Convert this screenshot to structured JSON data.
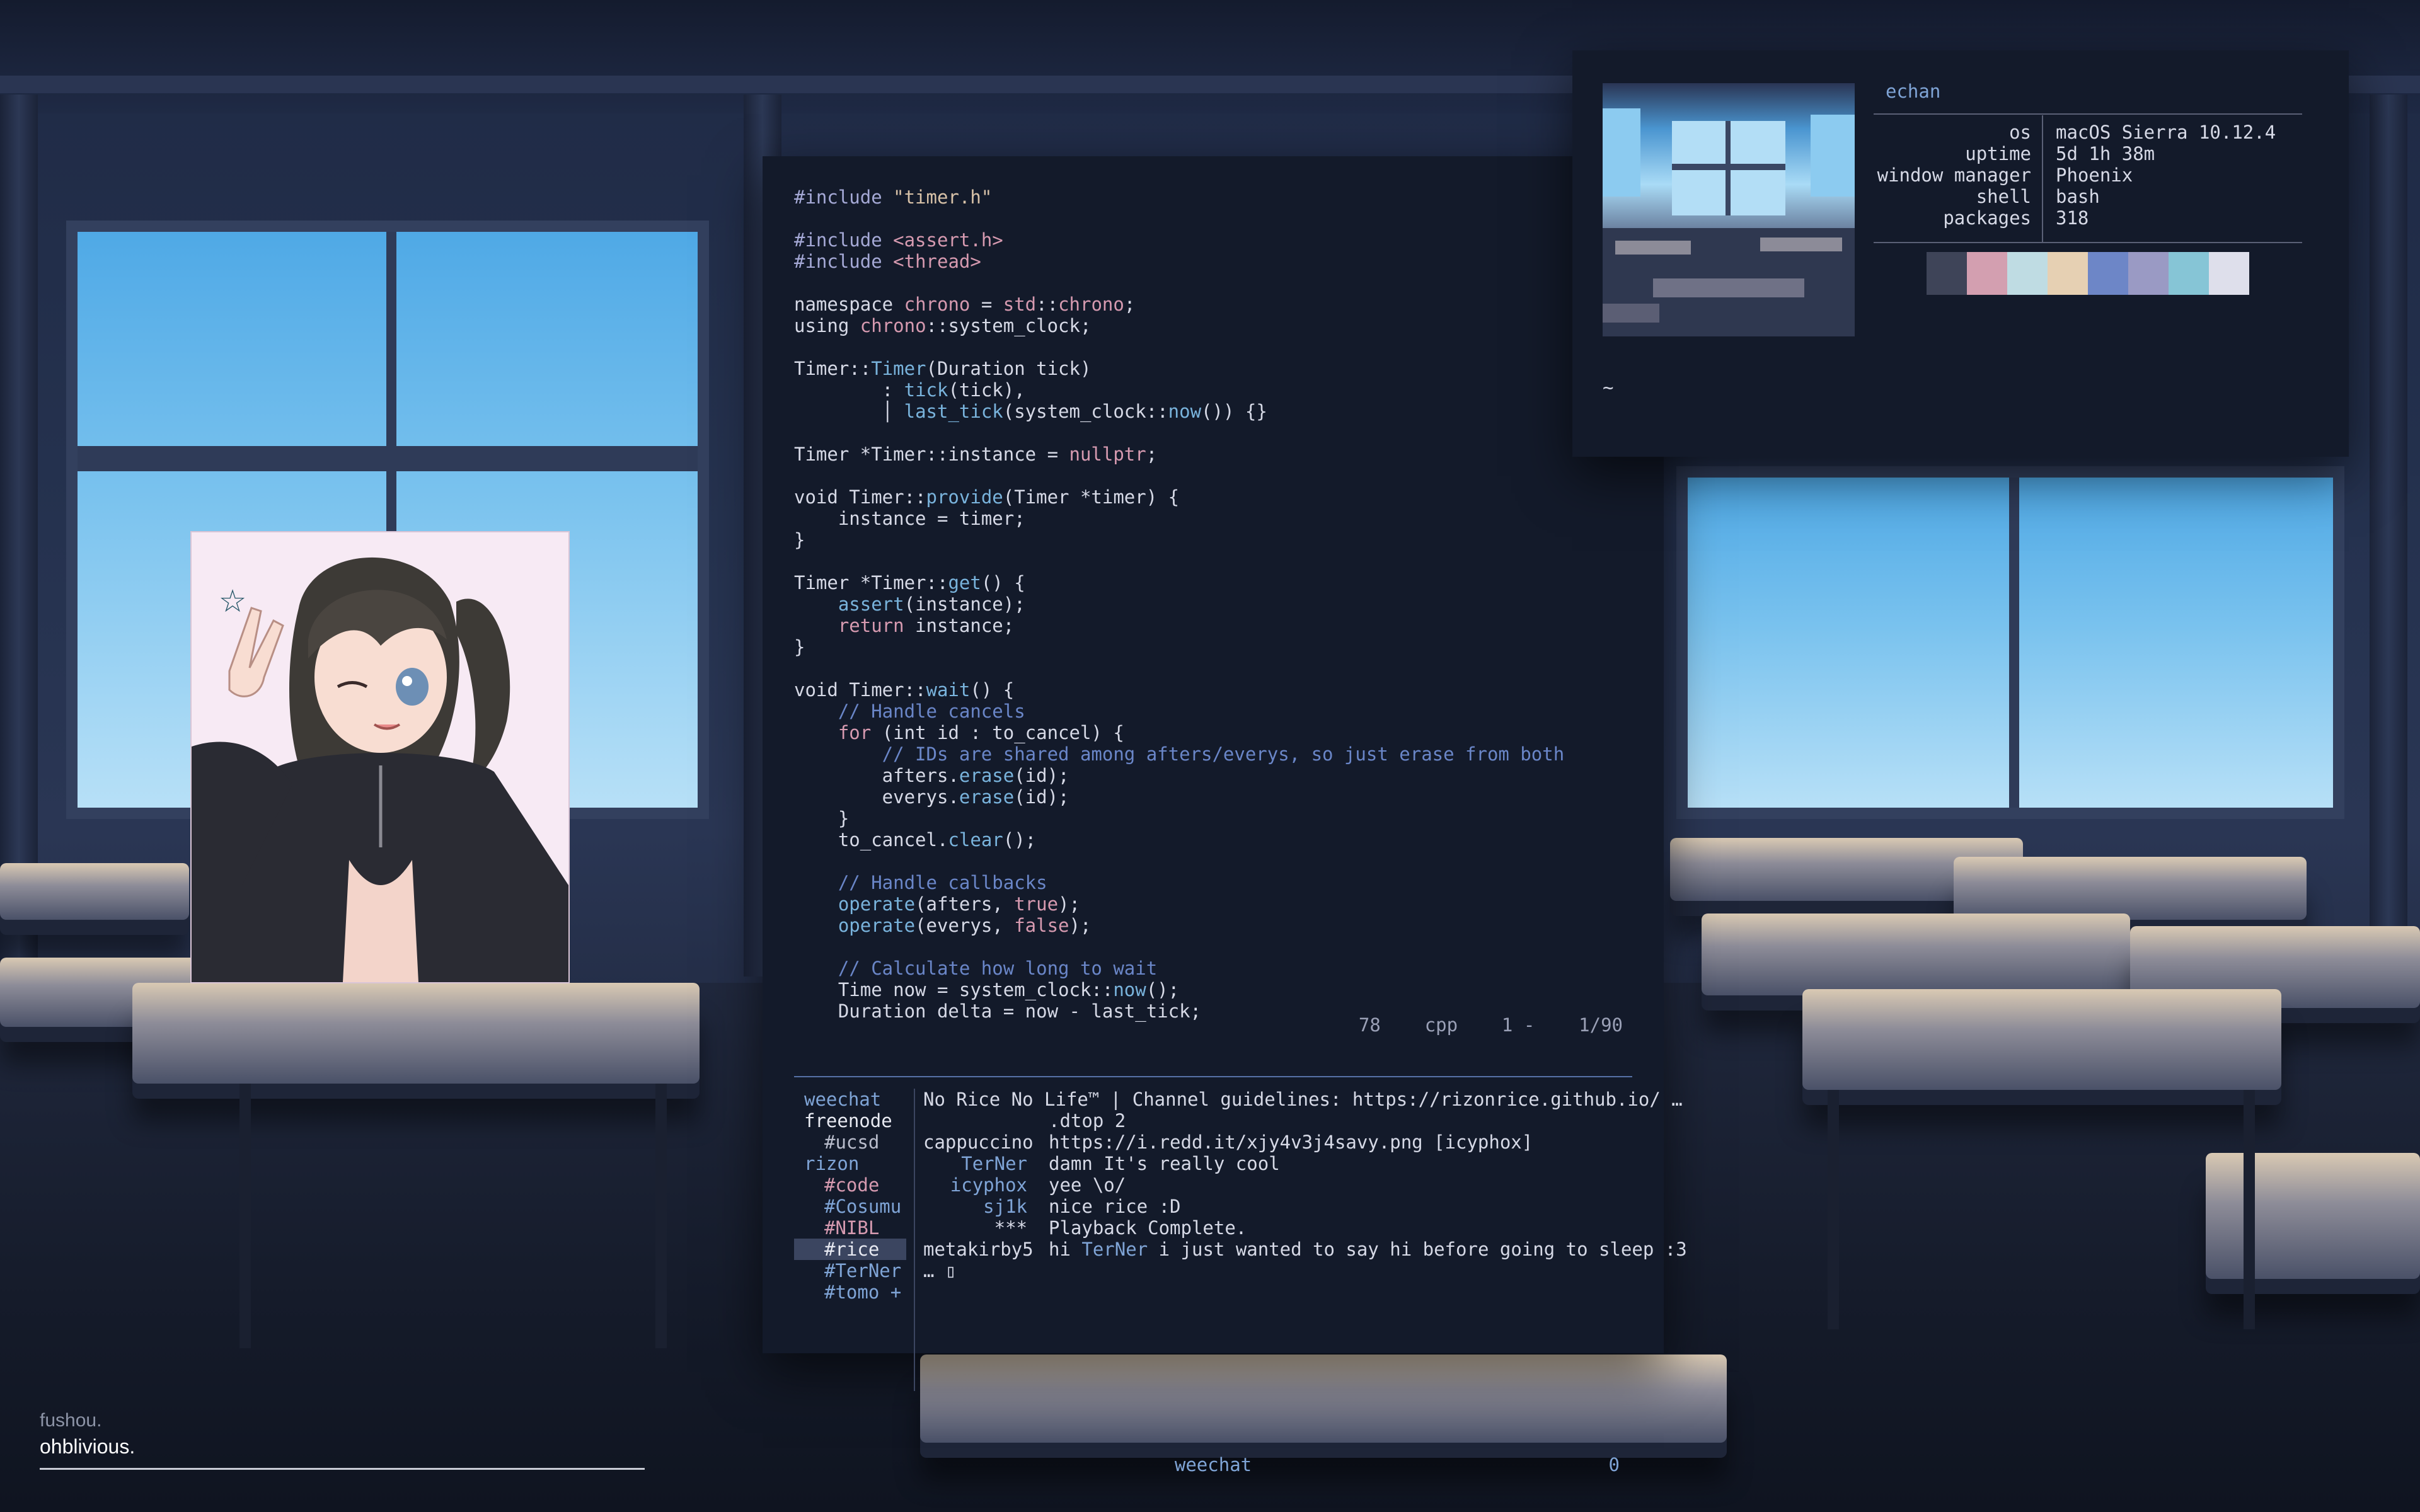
{
  "theme": {
    "editor_bg": "#131a2a",
    "accent": "#7fa4d6",
    "text": "#d6d9e6"
  },
  "editor": {
    "lines": [
      [
        [
          "pre",
          "#include "
        ],
        [
          "str",
          "\"timer.h\""
        ]
      ],
      [],
      [
        [
          "pre",
          "#include "
        ],
        [
          "inc",
          "<assert.h>"
        ]
      ],
      [
        [
          "pre",
          "#include "
        ],
        [
          "inc",
          "<thread>"
        ]
      ],
      [],
      [
        [
          "txt",
          "namespace "
        ],
        [
          "typ",
          "chrono"
        ],
        [
          "txt",
          " = "
        ],
        [
          "typ",
          "std"
        ],
        [
          "txt",
          "::"
        ],
        [
          "typ",
          "chrono"
        ],
        [
          "txt",
          ";"
        ]
      ],
      [
        [
          "txt",
          "using "
        ],
        [
          "typ",
          "chrono"
        ],
        [
          "txt",
          "::system_clock;"
        ]
      ],
      [],
      [
        [
          "txt",
          "Timer::"
        ],
        [
          "fn",
          "Timer"
        ],
        [
          "txt",
          "(Duration tick)"
        ]
      ],
      [
        [
          "txt",
          "        : "
        ],
        [
          "fn",
          "tick"
        ],
        [
          "txt",
          "(tick),"
        ]
      ],
      [
        [
          "txt",
          "        │ "
        ],
        [
          "fn",
          "last_tick"
        ],
        [
          "txt",
          "(system_clock::"
        ],
        [
          "fn",
          "now"
        ],
        [
          "txt",
          "()) {}"
        ]
      ],
      [],
      [
        [
          "txt",
          "Timer *Timer::instance = "
        ],
        [
          "typ",
          "nullptr"
        ],
        [
          "txt",
          ";"
        ]
      ],
      [],
      [
        [
          "txt",
          "void Timer::"
        ],
        [
          "fn",
          "provide"
        ],
        [
          "txt",
          "(Timer *timer) {"
        ]
      ],
      [
        [
          "txt",
          "    instance = timer;"
        ]
      ],
      [
        [
          "txt",
          "}"
        ]
      ],
      [],
      [
        [
          "txt",
          "Timer *Timer::"
        ],
        [
          "fn",
          "get"
        ],
        [
          "txt",
          "() {"
        ]
      ],
      [
        [
          "txt",
          "    "
        ],
        [
          "fn",
          "assert"
        ],
        [
          "txt",
          "(instance);"
        ]
      ],
      [
        [
          "txt",
          "    "
        ],
        [
          "kw",
          "return"
        ],
        [
          "txt",
          " instance;"
        ]
      ],
      [
        [
          "txt",
          "}"
        ]
      ],
      [],
      [
        [
          "txt",
          "void Timer::"
        ],
        [
          "fn",
          "wait"
        ],
        [
          "txt",
          "() {"
        ]
      ],
      [
        [
          "cm",
          "    // Handle cancels"
        ]
      ],
      [
        [
          "txt",
          "    "
        ],
        [
          "kw",
          "for"
        ],
        [
          "txt",
          " (int id : to_cancel) {"
        ]
      ],
      [
        [
          "cm",
          "        // IDs are shared among afters/everys, so just erase from both"
        ]
      ],
      [
        [
          "txt",
          "        afters."
        ],
        [
          "fn",
          "erase"
        ],
        [
          "txt",
          "(id);"
        ]
      ],
      [
        [
          "txt",
          "        everys."
        ],
        [
          "fn",
          "erase"
        ],
        [
          "txt",
          "(id);"
        ]
      ],
      [
        [
          "txt",
          "    }"
        ]
      ],
      [
        [
          "txt",
          "    to_cancel."
        ],
        [
          "fn",
          "clear"
        ],
        [
          "txt",
          "();"
        ]
      ],
      [],
      [
        [
          "cm",
          "    // Handle callbacks"
        ]
      ],
      [
        [
          "txt",
          "    "
        ],
        [
          "fn",
          "operate"
        ],
        [
          "txt",
          "(afters, "
        ],
        [
          "kw",
          "true"
        ],
        [
          "txt",
          ");"
        ]
      ],
      [
        [
          "txt",
          "    "
        ],
        [
          "fn",
          "operate"
        ],
        [
          "txt",
          "(everys, "
        ],
        [
          "kw",
          "false"
        ],
        [
          "txt",
          ");"
        ]
      ],
      [],
      [
        [
          "cm",
          "    // Calculate how long to wait"
        ]
      ],
      [
        [
          "txt",
          "    Time now = system_clock::"
        ],
        [
          "fn",
          "now"
        ],
        [
          "txt",
          "();"
        ]
      ],
      [
        [
          "txt",
          "    Duration delta = now - last_tick;"
        ]
      ]
    ],
    "status": {
      "column": "78",
      "filetype": "cpp",
      "line_pos": "1 -",
      "lines": "1/90"
    }
  },
  "weechat": {
    "buffers": [
      {
        "label": "weechat",
        "color": "#7fa4d6",
        "indent": false
      },
      {
        "label": "freenode",
        "color": "#e8eaf2",
        "indent": false
      },
      {
        "label": "#ucsd",
        "color": "#b9bdcc",
        "indent": true
      },
      {
        "label": "rizon",
        "color": "#7fa4d6",
        "indent": false
      },
      {
        "label": "#code",
        "color": "#d69ab0",
        "indent": true
      },
      {
        "label": "#Cosumu",
        "color": "#7fa4d6",
        "indent": true
      },
      {
        "label": "#NIBL",
        "color": "#d69ab0",
        "indent": true
      },
      {
        "label": "#rice",
        "color": "#e8eaf2",
        "indent": true,
        "selected": true
      },
      {
        "label": "#TerNer",
        "color": "#7fa4d6",
        "indent": true
      },
      {
        "label": "#tomo +",
        "color": "#7fa4d6",
        "indent": true
      }
    ],
    "topic": "No Rice No Life™ | Channel guidelines: https://rizonrice.github.io/ …",
    "messages": [
      {
        "nick": "",
        "nick_color": "#d6d9e6",
        "text": ".dtop 2"
      },
      {
        "nick": "cappuccino",
        "nick_color": "#d6d9e6",
        "text": "https://i.redd.it/xjy4v3j4savy.png [icyphox]"
      },
      {
        "nick": "TerNer",
        "nick_color": "#7fa4d6",
        "text": "damn It's really cool"
      },
      {
        "nick": "icyphox",
        "nick_color": "#7fa4d6",
        "text": "yee \\o/"
      },
      {
        "nick": "sj1k",
        "nick_color": "#7fa4d6",
        "text": "nice rice :D"
      },
      {
        "nick": "***",
        "nick_color": "#d6d9e6",
        "text": "Playback Complete."
      },
      {
        "nick": "metakirby5",
        "nick_color": "#d6d9e6",
        "text_parts": [
          "hi ",
          "TerNer",
          " i just wanted to say hi before going to sleep :3"
        ]
      }
    ],
    "input": "… ▯",
    "bar_label": "weechat",
    "bar_count": "0"
  },
  "fetch": {
    "user": "echan",
    "keys": [
      "os",
      "uptime",
      "window manager",
      "shell",
      "packages"
    ],
    "values": [
      "macOS Sierra 10.12.4",
      "5d 1h 38m",
      "Phoenix",
      "bash",
      "318"
    ],
    "palette": [
      "#3e4458",
      "#d39fb0",
      "#bfdce3",
      "#e6d0b3",
      "#6d86c7",
      "#9a9ac4",
      "#86c5d6",
      "#dedfeb"
    ],
    "prompt": "~"
  },
  "desktop": {
    "label_small": "fushou.",
    "label_main": "ohblivious."
  }
}
